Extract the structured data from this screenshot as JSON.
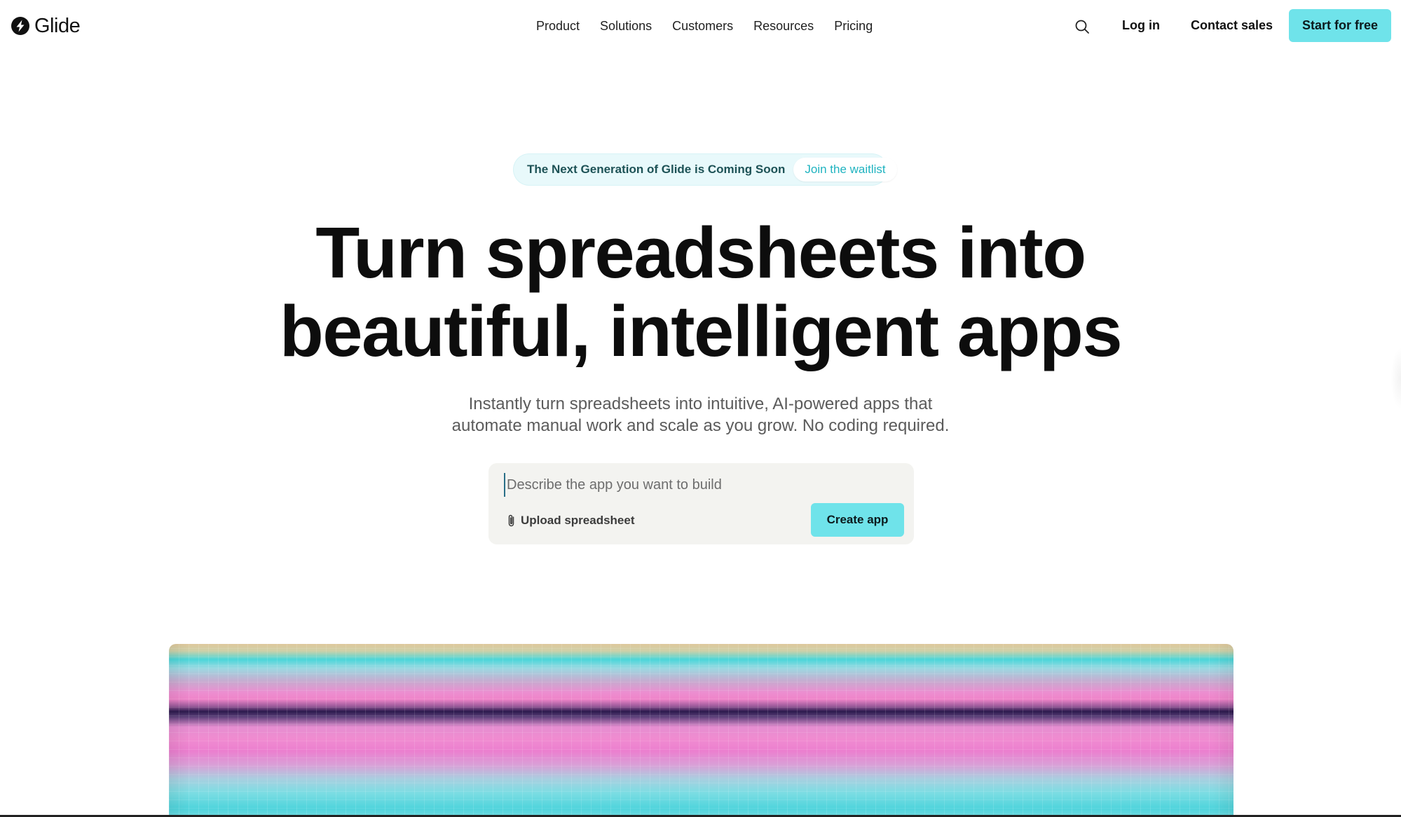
{
  "header": {
    "logo_text": "Glide",
    "nav": [
      {
        "label": "Product"
      },
      {
        "label": "Solutions"
      },
      {
        "label": "Customers"
      },
      {
        "label": "Resources"
      },
      {
        "label": "Pricing"
      }
    ],
    "search_icon": "search-icon",
    "login_label": "Log in",
    "contact_label": "Contact sales",
    "cta_label": "Start for free"
  },
  "announcement": {
    "text": "The Next Generation of Glide is Coming Soon",
    "link_label": "Join the waitlist"
  },
  "hero": {
    "title_line1": "Turn spreadsheets into",
    "title_line2": "beautiful, intelligent apps",
    "subtitle_line1": "Instantly turn spreadsheets into intuitive, AI-powered apps that",
    "subtitle_line2": "automate manual work and scale as you grow. No coding required."
  },
  "prompt": {
    "value": "",
    "placeholder": "Describe the app you want to build",
    "upload_icon": "paperclip-icon",
    "upload_label": "Upload spreadsheet",
    "create_label": "Create app"
  },
  "colors": {
    "accent": "#6fe3ea",
    "announcement_bg": "#e8f9fb",
    "announcement_link": "#1fb3c0",
    "prompt_bg": "#f3f3f0"
  }
}
